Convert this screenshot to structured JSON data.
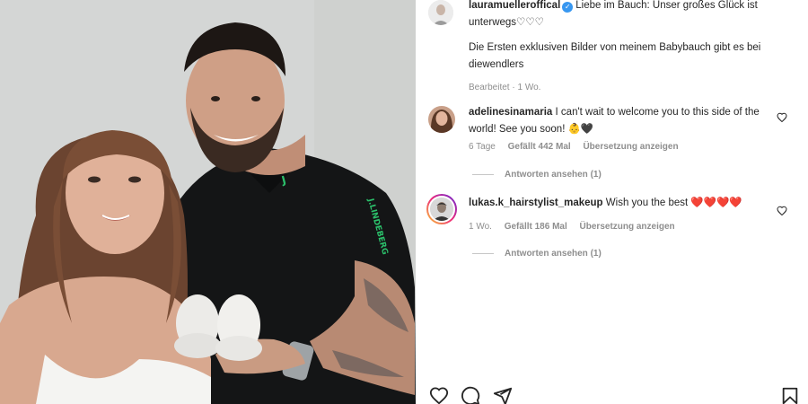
{
  "post": {
    "author": "lauramuelleroffical",
    "verified_glyph": "✓",
    "caption_line1": "Liebe im Bauch: Unser großes Glück ist unterwegs♡♡♡",
    "caption_line2": "Die Ersten exklusiven Bilder von meinem Babybauch gibt es bei diewendlers",
    "edited": "Bearbeitet · 1 Wo."
  },
  "comments": [
    {
      "username": "adelinesinamaria",
      "text": "I can't wait to welcome you to this side of the world! See you soon! 👶🖤",
      "time": "6 Tage",
      "likes": "Gefällt 442 Mal",
      "translate": "Übersetzung anzeigen",
      "replies": "Antworten ansehen (1)"
    },
    {
      "username": "lukas.k_hairstylist_makeup",
      "text": "Wish you the best ❤️❤️❤️❤️",
      "time": "1 Wo.",
      "likes": "Gefällt 186 Mal",
      "translate": "Übersetzung anzeigen",
      "replies": "Antworten ansehen (1)"
    }
  ],
  "shirt_brand": "J.LINDEBERG",
  "icons": {
    "like": "heart-icon",
    "comment": "comment-icon",
    "share": "send-icon",
    "save": "bookmark-icon",
    "comment_like": "heart-outline-icon",
    "verified": "verified-badge-icon"
  },
  "colors": {
    "verified": "#3897f0",
    "muted": "#8e8e8e",
    "text": "#262626",
    "shirt_accent": "#2bbf6a"
  }
}
